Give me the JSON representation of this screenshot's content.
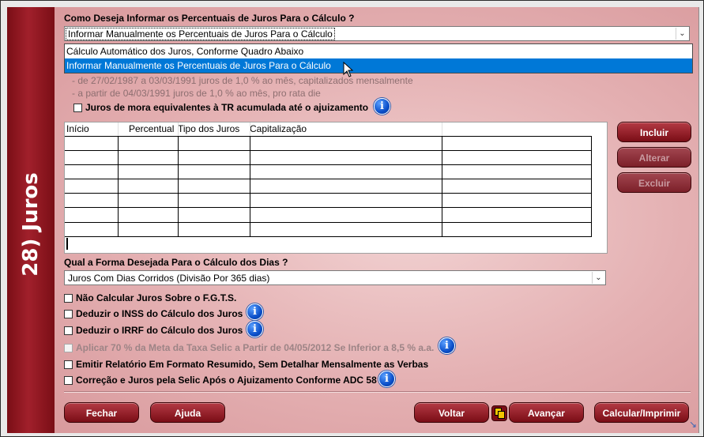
{
  "sidebar": {
    "title": "28) Juros"
  },
  "percent_section": {
    "label": "Como Deseja Informar os Percentuais de Juros Para o Cálculo ?",
    "selected": "Informar Manualmente os Percentuais de Juros Para o Cálculo",
    "options": [
      "Cálculo Automático dos Juros, Conforme Quadro Abaixo",
      "Informar Manualmente os Percentuais de Juros Para o Cálculo"
    ],
    "notes": [
      "- de 27/02/1987 a 03/03/1991 juros de 1,0 % ao mês, capitalizados mensalmente",
      "- a partir de 04/03/1991 juros de 1,0 % ao mês, pro rata die"
    ],
    "tr_checkbox": "Juros de mora equivalentes à TR acumulada até o ajuizamento"
  },
  "table": {
    "columns": [
      "Início",
      "Percentual",
      "Tipo dos Juros",
      "Capitalização"
    ]
  },
  "side_buttons": {
    "add": "Incluir",
    "edit": "Alterar",
    "delete": "Excluir"
  },
  "days_section": {
    "label": "Qual a Forma Desejada Para o Cálculo dos Dias ?",
    "selected": "Juros Com Dias Corridos (Divisão Por 365 dias)"
  },
  "options": [
    "Não Calcular Juros Sobre o F.G.T.S.",
    "Deduzir o INSS do Cálculo dos Juros",
    "Deduzir o IRRF do Cálculo dos Juros",
    "Aplicar 70 % da Meta da Taxa Selic a Partir de 04/05/2012 Se Inferior a 8,5 % a.a.",
    "Emitir Relatório Em Formato Resumido, Sem Detalhar Mensalmente as Verbas",
    "Correção e Juros pela Selic Após o Ajuizamento Conforme ADC 58"
  ],
  "footer": {
    "close": "Fechar",
    "help": "Ajuda",
    "back": "Voltar",
    "next": "Avançar",
    "calc": "Calcular/Imprimir"
  },
  "colors": {
    "brand": "#8b1a22",
    "selection": "#0078d7"
  }
}
